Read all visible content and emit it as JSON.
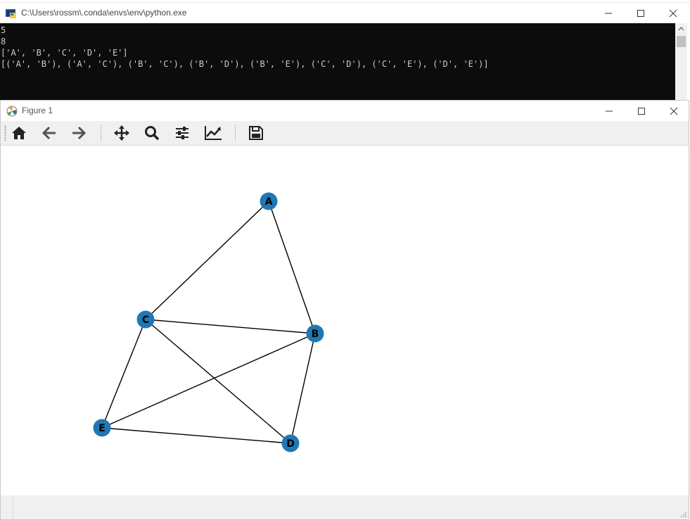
{
  "console_window": {
    "title": "C:\\Users\\rossm\\.conda\\envs\\env\\python.exe",
    "output_lines": [
      "5",
      "8",
      "['A', 'B', 'C', 'D', 'E']",
      "[('A', 'B'), ('A', 'C'), ('B', 'C'), ('B', 'D'), ('B', 'E'), ('C', 'D'), ('C', 'E'), ('D', 'E')]"
    ],
    "colors": {
      "background": "#0c0c0c",
      "text": "#cccccc"
    }
  },
  "figure_window": {
    "title": "Figure 1",
    "toolbar": {
      "buttons": [
        "home-icon",
        "back-arrow-icon",
        "forward-arrow-icon",
        "pan-icon",
        "zoom-icon",
        "subplots-config-icon",
        "edit-axis-icon",
        "save-icon"
      ]
    }
  },
  "graph": {
    "node_color": "#1f78b4",
    "label_color": "#000000",
    "nodes": [
      "A",
      "B",
      "C",
      "D",
      "E"
    ],
    "edges": [
      [
        "A",
        "B"
      ],
      [
        "A",
        "C"
      ],
      [
        "B",
        "C"
      ],
      [
        "B",
        "D"
      ],
      [
        "B",
        "E"
      ],
      [
        "C",
        "D"
      ],
      [
        "C",
        "E"
      ],
      [
        "D",
        "E"
      ]
    ]
  }
}
